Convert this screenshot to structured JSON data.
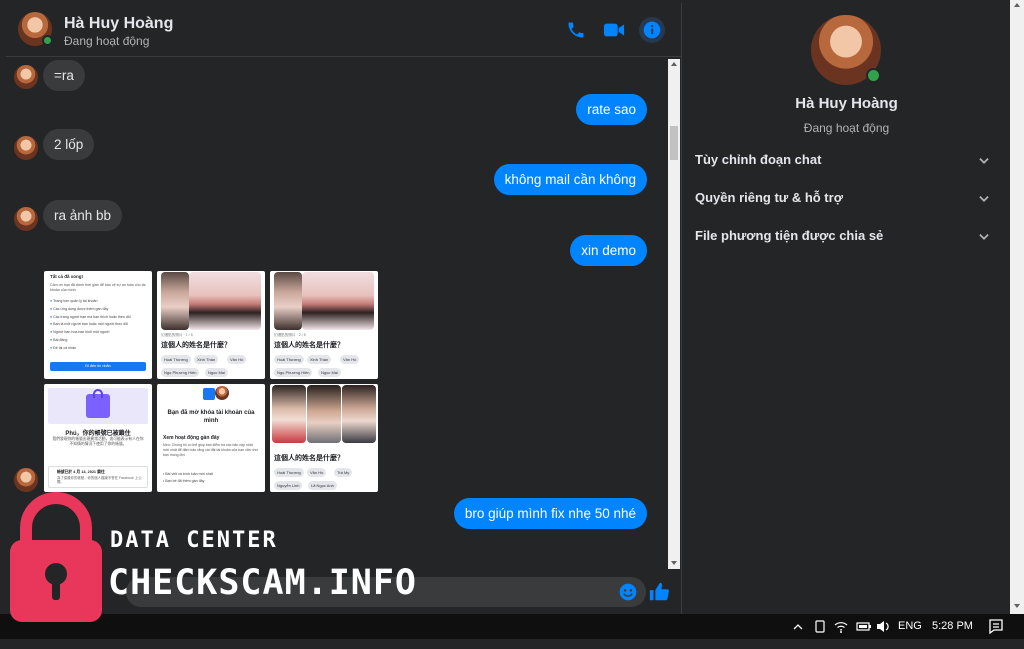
{
  "header": {
    "name": "Hà Huy Hoàng",
    "status": "Đang hoạt động"
  },
  "messages": [
    {
      "side": "in",
      "text": "=ra"
    },
    {
      "side": "out",
      "text": "rate sao"
    },
    {
      "side": "in",
      "text": "2 lốp"
    },
    {
      "side": "out",
      "text": "không mail cần không"
    },
    {
      "side": "in",
      "text": "ra ảnh bb"
    },
    {
      "side": "out",
      "text": "xin demo"
    },
    {
      "side": "out",
      "text": "bro giúp mình fix nhẹ 50 nhé"
    }
  ],
  "images": {
    "t1": {
      "title": "Tất cả đã xong!",
      "intro": "Cảm ơn bạn đã dành thời gian để bảo vệ sự an toàn cho tài khoản của mình.",
      "checks": [
        "Trang tóm quản lý tài khoản",
        "Các ứng dụng được thêm gần đây",
        "Các trang người bạn mà bạn thích hoặc theo dõi",
        "Bạn là một người bạn hoặc một người theo dõi",
        "Người bạn hoa bạn khỏi một người",
        "Bài đăng",
        "Đề lại cá nhân"
      ],
      "button": "Đi đến tin nhắn"
    },
    "t2": {
      "top": "幻燈貼的照片 · 1 / 5",
      "title": "這個人的姓名是什麼？",
      "chips": [
        "Hoài Thương",
        "Xinh Thần",
        "Văn Hồ",
        "Ngọ Phương Hiên",
        "Ngọc Mai"
      ]
    },
    "t3": {
      "top": "幻燈貼的照片 · 2 / 5",
      "title": "這個人的姓名是什麼？",
      "chips": [
        "Hoài Thương",
        "Xinh Thần",
        "Văn Hồ",
        "Ngọ Phương Hiên",
        "Ngọc Mai"
      ]
    },
    "t4": {
      "title": "Phú，你的帳號已被鎖住",
      "body": "我們發現你的帳號出現異常活動，這可能表示有人在你不知情的情況下使用了你的帳號。",
      "footer": "帳號已於 4 月 13, 2021 鎖住",
      "footer2": "為了保護你的帳號，你的個人檔案不會在 Facebook 上公開。"
    },
    "t5": {
      "title": "Bạn đã mở khóa tài khoản của mình",
      "subtitle": "Xem hoạt động gần đây",
      "body": "Meo: Chúng tôi có thể giúp bạn kiểm tra các bản cập nhật mới nhất để đảm bảo rằng cài đặt tài khoản của bạn vẫn như bạn mong đợi.",
      "item1": "Bài viết và bình luận mới nhất",
      "item2": "Bạn bè đã thêm gần đây"
    },
    "t6": {
      "title": "這個人的姓名是什麼？",
      "chips": [
        "Hoài Thương",
        "Văn Hồ",
        "Trà My",
        "Nguyễn Linh",
        "Lã Ngọc Anh"
      ]
    }
  },
  "side": {
    "name": "Hà Huy Hoàng",
    "status": "Đang hoạt động",
    "items": [
      {
        "label": "Tùy chỉnh đoạn chat"
      },
      {
        "label": "Quyền riêng tư & hỗ trợ"
      },
      {
        "label": "File phương tiện được chia sẻ"
      }
    ]
  },
  "watermark": {
    "line1": "DATA CENTER",
    "line2": "CHECKSCAM.INFO"
  },
  "taskbar": {
    "lang": "ENG",
    "time": "5:28 PM"
  },
  "colors": {
    "accent": "#0084ff",
    "bg": "#242526",
    "bubble_in": "#3a3b3c",
    "online": "#31a24c",
    "lock": "#e8375a"
  }
}
